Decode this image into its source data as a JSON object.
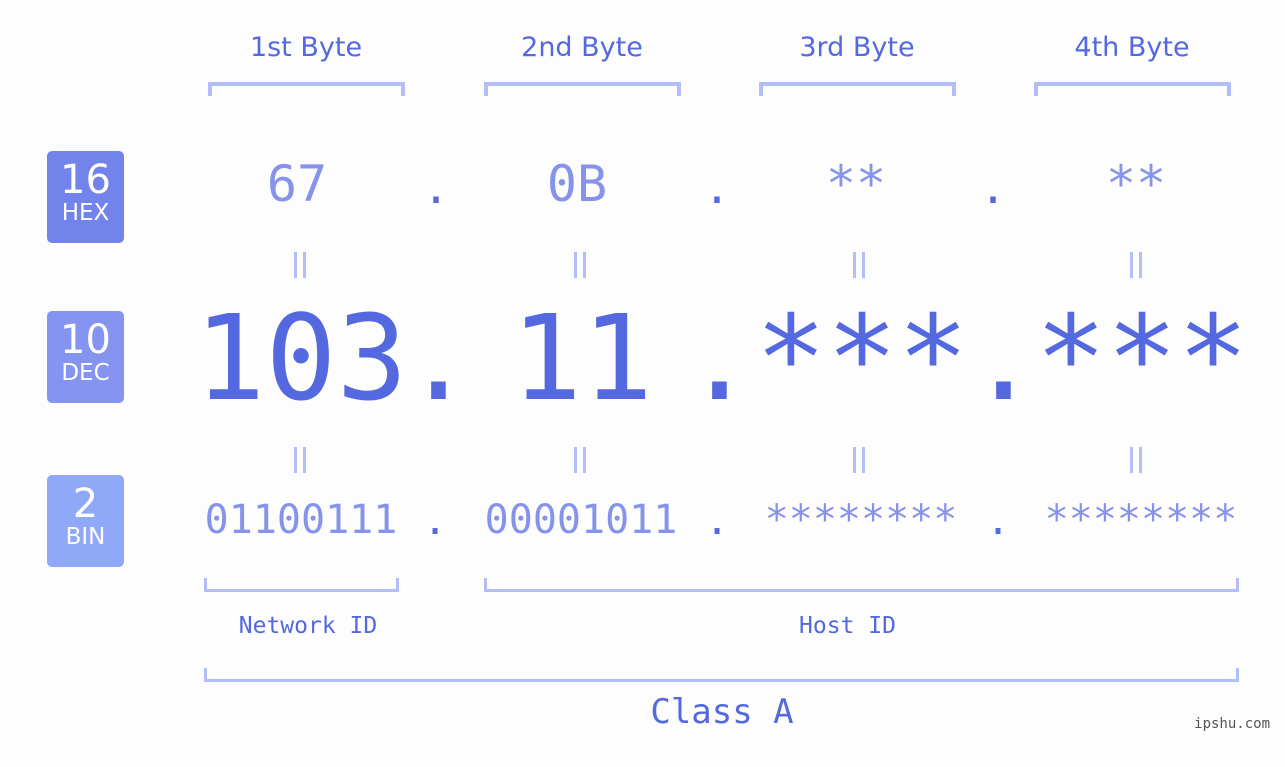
{
  "headers": {
    "bytes": [
      "1st Byte",
      "2nd Byte",
      "3rd Byte",
      "4th Byte"
    ]
  },
  "badges": {
    "hex": {
      "number": "16",
      "label": "HEX",
      "color": "#7383ec"
    },
    "dec": {
      "number": "10",
      "label": "DEC",
      "color": "#8494f0"
    },
    "bin": {
      "number": "2",
      "label": "BIN",
      "color": "#8fa8f8"
    }
  },
  "hex": {
    "octets": [
      "67",
      "0B",
      "**",
      "**"
    ],
    "separator": "."
  },
  "dec": {
    "octets": [
      "103",
      "11",
      "***",
      "***"
    ],
    "separator": "."
  },
  "bin": {
    "octets": [
      "01100111",
      "00001011",
      "********",
      "********"
    ],
    "separator": "."
  },
  "equals_symbol": "=",
  "segments": {
    "network_id": "Network ID",
    "host_id": "Host ID"
  },
  "class_label": "Class A",
  "watermark": "ipshu.com",
  "colors": {
    "primary": "#5468e0",
    "light_value": "#8593ec",
    "bracket": "#b3bdf6",
    "background": "#fcfdfc"
  }
}
